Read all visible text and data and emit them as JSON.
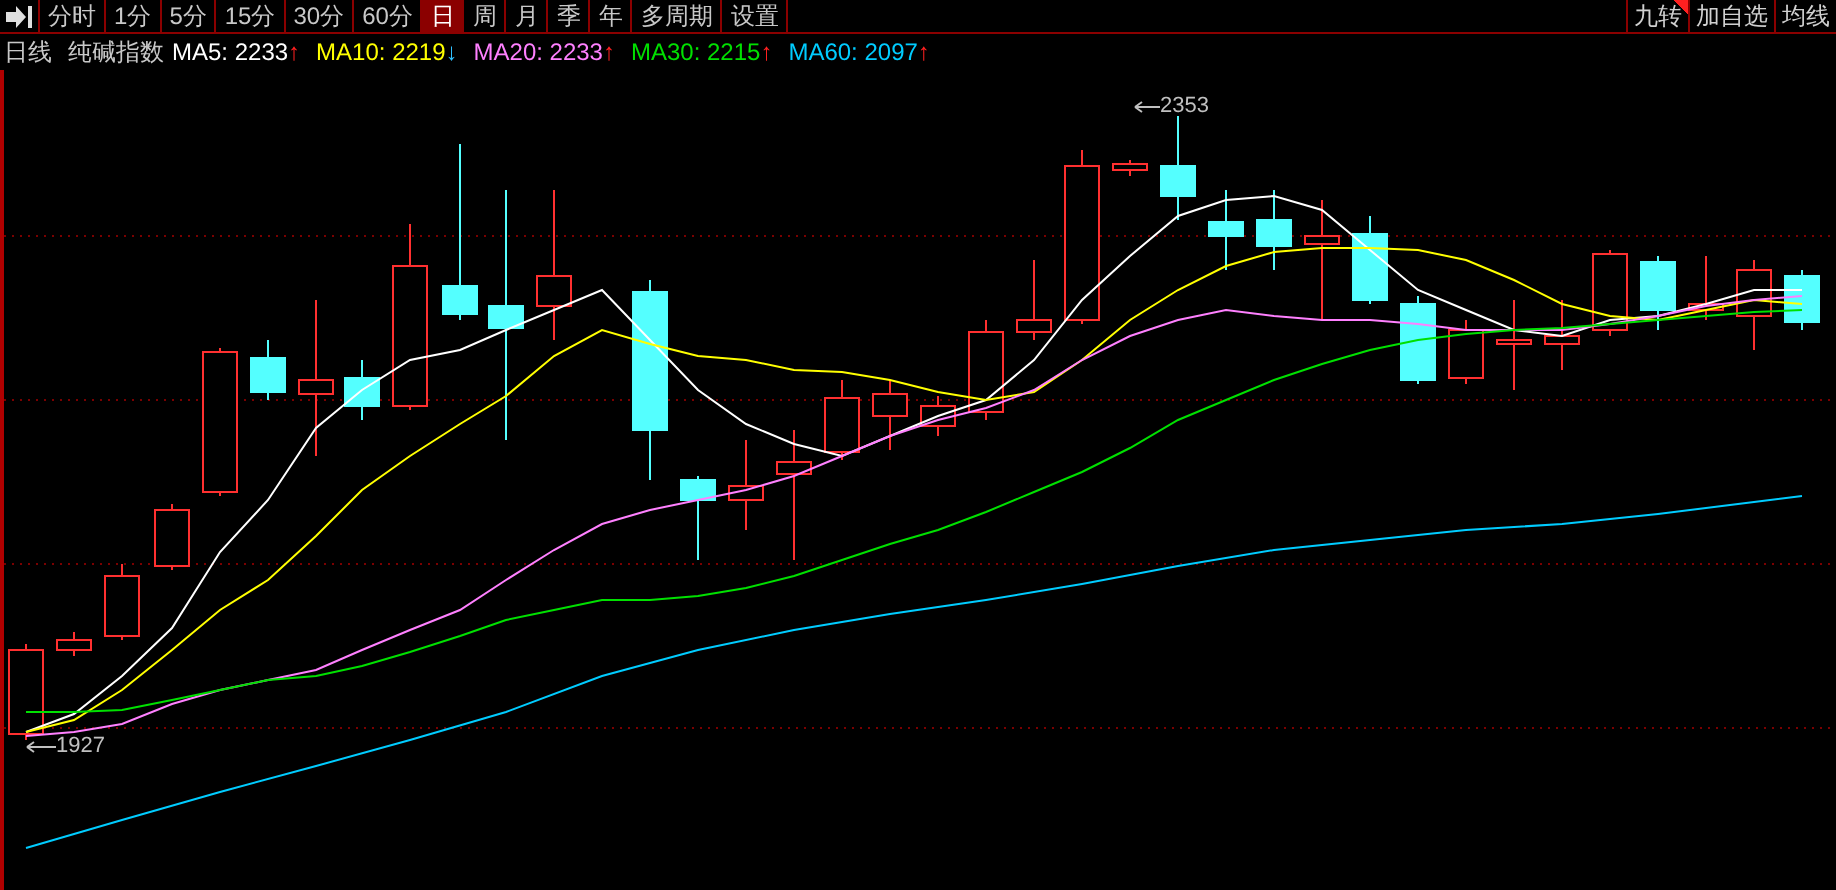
{
  "toolbar": {
    "tabs": [
      {
        "label": "分时",
        "selected": false
      },
      {
        "label": "1分",
        "selected": false
      },
      {
        "label": "5分",
        "selected": false
      },
      {
        "label": "15分",
        "selected": false
      },
      {
        "label": "30分",
        "selected": false
      },
      {
        "label": "60分",
        "selected": false
      },
      {
        "label": "日",
        "selected": true
      },
      {
        "label": "周",
        "selected": false
      },
      {
        "label": "月",
        "selected": false
      },
      {
        "label": "季",
        "selected": false
      },
      {
        "label": "年",
        "selected": false
      },
      {
        "label": "多周期",
        "selected": false
      },
      {
        "label": "设置",
        "selected": false
      }
    ],
    "right_buttons": [
      {
        "label": "九转",
        "flagged": true
      },
      {
        "label": "加自选",
        "flagged": false
      },
      {
        "label": "均线",
        "flagged": false
      }
    ]
  },
  "legend": {
    "period": "日线",
    "name": "纯碱指数",
    "indicators": [
      {
        "label": "MA5: 2233",
        "color": "#ffffff",
        "rising": true,
        "arrow": "↑"
      },
      {
        "label": "MA10: 2219",
        "color": "#ffff00",
        "rising": false,
        "arrow": "↓"
      },
      {
        "label": "MA20: 2233",
        "color": "#ff80ff",
        "rising": true,
        "arrow": "↑"
      },
      {
        "label": "MA30: 2215",
        "color": "#00e000",
        "rising": true,
        "arrow": "↑"
      },
      {
        "label": "MA60: 2097",
        "color": "#00ccff",
        "rising": true,
        "arrow": "↑"
      }
    ]
  },
  "chart": {
    "high_label": "2353",
    "low_label": "1927"
  }
}
